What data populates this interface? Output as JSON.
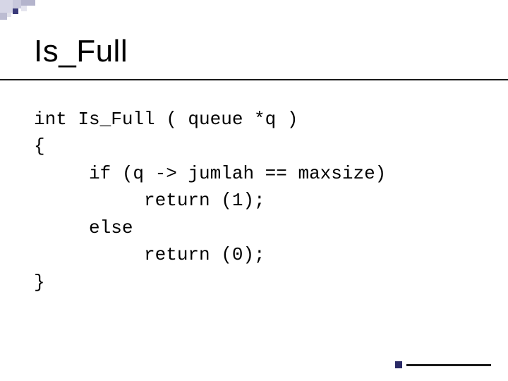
{
  "slide": {
    "title": "Is_Full",
    "code_lines": [
      "int Is_Full ( queue *q )",
      "{",
      "     if (q -> jumlah == maxsize)",
      "          return (1);",
      "     else",
      "          return (0);",
      "}"
    ]
  }
}
